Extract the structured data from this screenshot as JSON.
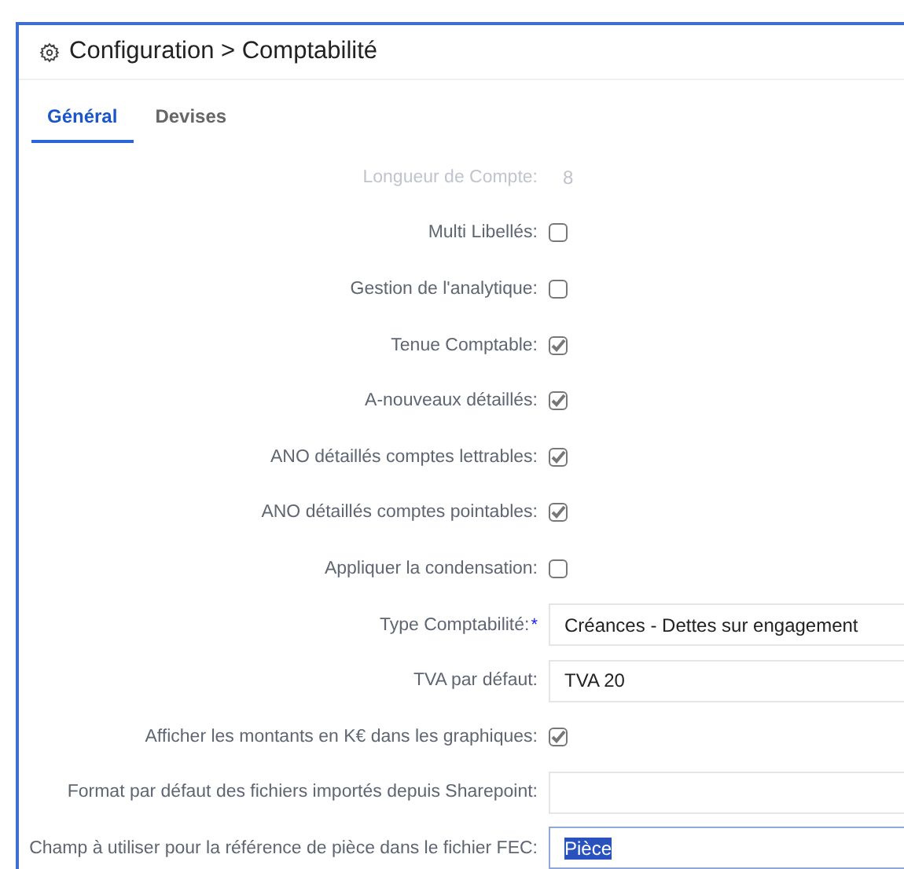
{
  "header": {
    "title": "Configuration > Comptabilité"
  },
  "tabs": [
    {
      "label": "Général",
      "selected": true
    },
    {
      "label": "Devises",
      "selected": false
    }
  ],
  "fields": [
    {
      "kind": "text",
      "label": "Longueur de Compte:",
      "value": "8",
      "disabled": true
    },
    {
      "kind": "checkbox",
      "label": "Multi Libellés:",
      "checked": false,
      "disabled": false
    },
    {
      "kind": "checkbox",
      "label": "Gestion de l'analytique:",
      "checked": false,
      "disabled": false
    },
    {
      "kind": "checkbox",
      "label": "Tenue Comptable:",
      "checked": true,
      "disabled": false
    },
    {
      "kind": "checkbox",
      "label": "A-nouveaux détaillés:",
      "checked": true,
      "disabled": false
    },
    {
      "kind": "checkbox",
      "label": "ANO détaillés comptes lettrables:",
      "checked": true,
      "disabled": false
    },
    {
      "kind": "checkbox",
      "label": "ANO détaillés comptes pointables:",
      "checked": true,
      "disabled": false
    },
    {
      "kind": "checkbox",
      "label": "Appliquer la condensation:",
      "checked": false,
      "disabled": false
    },
    {
      "kind": "input",
      "label": "Type Comptabilité:",
      "required_mark": "*",
      "value": "Créances - Dettes sur engagement",
      "focused": false,
      "disabled": false
    },
    {
      "kind": "input",
      "label": "TVA par défaut:",
      "value": "TVA 20",
      "focused": false,
      "disabled": false
    },
    {
      "kind": "checkbox",
      "label": "Afficher les montants en K€ dans les graphiques:",
      "checked": true,
      "disabled": false
    },
    {
      "kind": "input",
      "label": "Format par défaut des fichiers importés depuis Sharepoint:",
      "focused": false,
      "disabled": false
    },
    {
      "kind": "input",
      "label": "Champ à utiliser pour la référence de pièce dans le fichier FEC:",
      "value": "Pièce",
      "focused": true,
      "disabled": false
    }
  ]
}
